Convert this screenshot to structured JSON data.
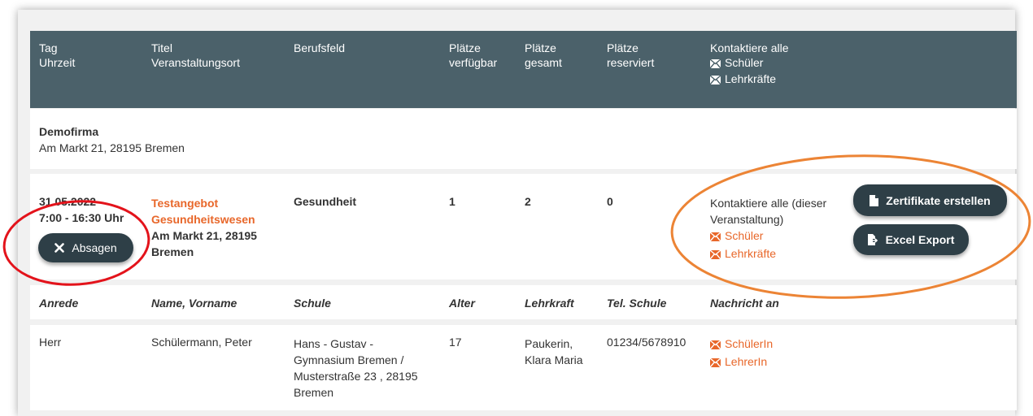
{
  "header": {
    "col_tag": [
      "Tag",
      "Uhrzeit"
    ],
    "col_titel": [
      "Titel",
      "Veranstaltungsort"
    ],
    "col_berufsfeld": "Berufsfeld",
    "col_verfuegbar": [
      "Plätze",
      "verfügbar"
    ],
    "col_gesamt": [
      "Plätze",
      "gesamt"
    ],
    "col_reserviert": [
      "Plätze",
      "reserviert"
    ],
    "col_kontakt": "Kontaktiere alle",
    "kontakt_schueler": "Schüler",
    "kontakt_lehrkraefte": "Lehrkräfte"
  },
  "company": {
    "name": "Demofirma",
    "address": "Am Markt 21, 28195 Bremen"
  },
  "event": {
    "date": "31.05.2022",
    "time": "7:00 - 16:30 Uhr",
    "cancel_label": "Absagen",
    "title_lines": [
      "Testangebot",
      "Gesundheitswesen"
    ],
    "location_lines": [
      "Am Markt 21, 28195",
      "Bremen"
    ],
    "berufsfeld": "Gesundheit",
    "plaetze_verfuegbar": "1",
    "plaetze_gesamt": "2",
    "plaetze_reserviert": "0",
    "kontakt_lines": [
      "Kontaktiere alle (dieser",
      "Veranstaltung)"
    ],
    "kontakt_schueler": "Schüler",
    "kontakt_lehrkraefte": "Lehrkräfte",
    "zertifikate_label": "Zertifikate erstellen",
    "excel_label": "Excel Export"
  },
  "participants": {
    "headers": [
      "Anrede",
      "Name, Vorname",
      "Schule",
      "Alter",
      "Lehrkraft",
      "Tel. Schule",
      "Nachricht an"
    ],
    "rows": [
      {
        "anrede": "Herr",
        "name": "Schülermann, Peter",
        "schule_lines": [
          "Hans - Gustav -",
          "Gymnasium Bremen /",
          "Musterstraße 23 , 28195",
          "Bremen"
        ],
        "alter": "17",
        "lehrkraft_lines": [
          "Paukerin,",
          "Klara Maria"
        ],
        "tel": "01234/5678910",
        "msg_schueler": "SchülerIn",
        "msg_lehrer": "LehrerIn"
      }
    ]
  },
  "colors": {
    "header_bg": "#4b616a",
    "button_bg": "#2e3f47",
    "link_orange": "#e8672a",
    "annotation_red": "#e3131b",
    "annotation_orange": "#ec8435"
  }
}
